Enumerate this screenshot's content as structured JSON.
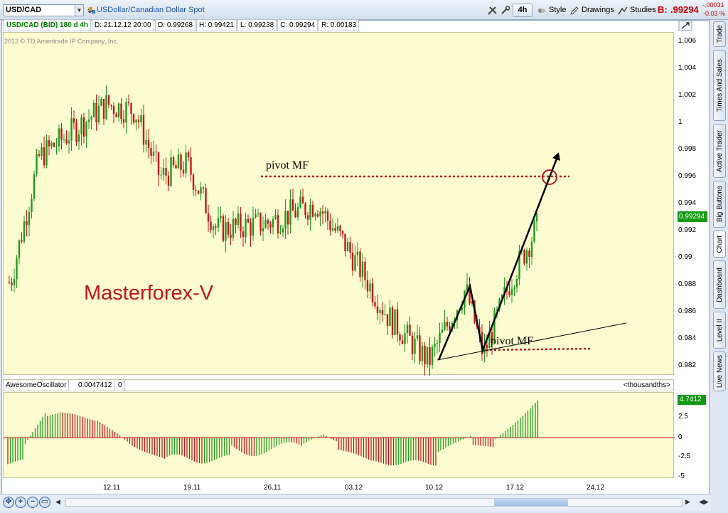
{
  "toolbar": {
    "symbol": "USD/CAD",
    "description": "USDollar/Canadian Dollar Spot",
    "timeframe": "4h",
    "style_label": "Style",
    "drawings_label": "Drawings",
    "studies_label": "Studies",
    "bid_label": "B:",
    "bid_value": ".99294",
    "change_abs": "-.00031",
    "change_pct": "-0.03 %"
  },
  "infobar": {
    "symbol_period": "USD/CAD (BID) 180 d 4h",
    "date": "D: 21.12.12 20:00",
    "open": "O: 0.99268",
    "high": "H: 0.99421",
    "low": "L: 0.99238",
    "close": "C: 0.99294",
    "range": "R: 0.00183"
  },
  "copyright": "2012 © TD Ameritrade IP Company, Inc.",
  "annotations": {
    "brand": "Masterforex-V",
    "pivot_top": "pivot MF",
    "pivot_bottom": "pivot MF"
  },
  "price_axis": {
    "ticks": [
      "1.006",
      "1.004",
      "1.002",
      "1",
      "0.998",
      "0.996",
      "0.994",
      "0.992",
      "0.99",
      "0.988",
      "0.986",
      "0.984",
      "0.982"
    ],
    "last_price": "0.99294"
  },
  "oscillator": {
    "name": "AwesomeOscillator",
    "value": "0.0047412",
    "param": "0",
    "units": "<thousandths>",
    "tag": "4.7412",
    "ticks": [
      "5",
      "2.5",
      "0",
      "-2.5",
      "-5"
    ]
  },
  "x_axis": {
    "labels": [
      "12.11",
      "19.11",
      "26.11",
      "03.12",
      "10.12",
      "17.12",
      "24.12"
    ]
  },
  "side_tabs": [
    "Trade",
    "Times And Sales",
    "Active Trader",
    "Big Buttons",
    "Chart",
    "Dashboard",
    "Level II",
    "Live News"
  ],
  "colors": {
    "up_candle": "#1e9a1e",
    "down_candle": "#c8141b",
    "panel_bg": "#fcfcd0",
    "annotation_red": "#c0151b"
  },
  "chart_data": {
    "type": "candlestick",
    "timeframe": "4h",
    "x_range": [
      "06.11.12",
      "24.12.12"
    ],
    "ylim": [
      0.981,
      1.007
    ],
    "approx_close_path": [
      {
        "date": "06.11",
        "price": 0.9885
      },
      {
        "date": "08.11",
        "price": 0.998
      },
      {
        "date": "12.11",
        "price": 1.002
      },
      {
        "date": "14.11",
        "price": 1.0015
      },
      {
        "date": "16.11",
        "price": 0.9965
      },
      {
        "date": "19.11",
        "price": 0.9975
      },
      {
        "date": "21.11",
        "price": 0.9925
      },
      {
        "date": "26.11",
        "price": 0.993
      },
      {
        "date": "29.11",
        "price": 0.9945
      },
      {
        "date": "03.12",
        "price": 0.991
      },
      {
        "date": "06.12",
        "price": 0.986
      },
      {
        "date": "10.12",
        "price": 0.9825
      },
      {
        "date": "12.12",
        "price": 0.988
      },
      {
        "date": "14.12",
        "price": 0.983
      },
      {
        "date": "17.12",
        "price": 0.9885
      },
      {
        "date": "21.12",
        "price": 0.9929
      }
    ],
    "oscillator_range": [
      -5,
      5
    ]
  }
}
